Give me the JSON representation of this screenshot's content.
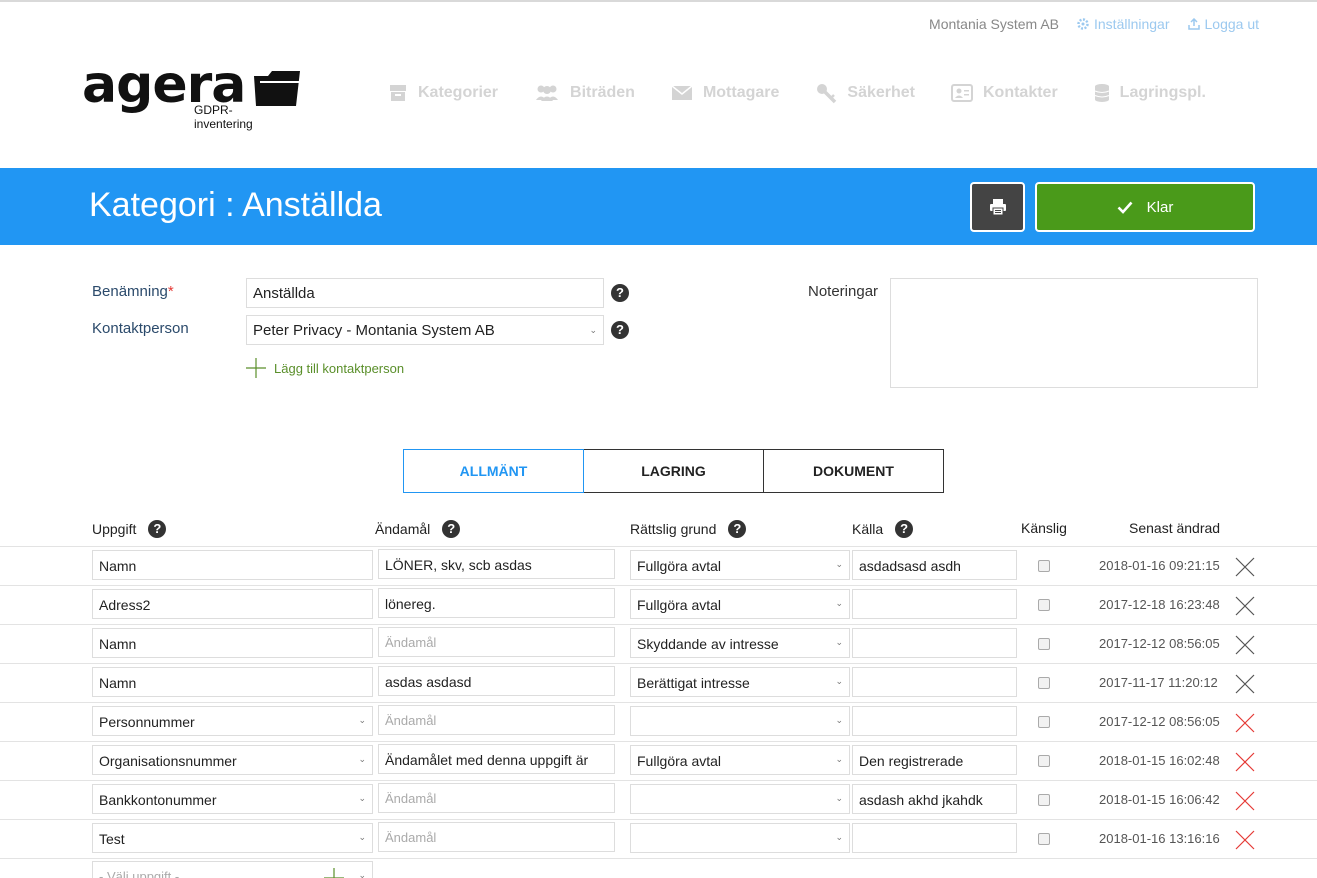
{
  "topbar": {
    "company": "Montania System AB",
    "settings": "Inställningar",
    "logout": "Logga ut"
  },
  "logo": {
    "word": "agera",
    "sub": "GDPR-inventering"
  },
  "nav": [
    {
      "label": "Kategorier",
      "icon": "archive-icon"
    },
    {
      "label": "Biträden",
      "icon": "users-icon"
    },
    {
      "label": "Mottagare",
      "icon": "envelope-icon"
    },
    {
      "label": "Säkerhet",
      "icon": "key-icon"
    },
    {
      "label": "Kontakter",
      "icon": "contact-card-icon"
    },
    {
      "label": "Lagringspl.",
      "icon": "database-icon"
    }
  ],
  "header": {
    "title": "Kategori : Anställda",
    "done_label": "Klar"
  },
  "form": {
    "name_label": "Benämning",
    "name_value": "Anställda",
    "contact_label": "Kontaktperson",
    "contact_value": "Peter Privacy - Montania System AB",
    "add_contact": "Lägg till kontaktperson",
    "notes_label": "Noteringar"
  },
  "tabs": [
    "ALLMÄNT",
    "LAGRING",
    "DOKUMENT"
  ],
  "columns": {
    "uppgift": "Uppgift",
    "andamal": "Ändamål",
    "grund": "Rättslig grund",
    "kalla": "Källa",
    "kanslig": "Känslig",
    "andrad": "Senast ändrad"
  },
  "placeholder_andamal": "Ändamål",
  "rows": [
    {
      "uppgift": "Namn",
      "uppgift_select": false,
      "andamal": "LÖNER, skv, scb asdas",
      "grund": "Fullgöra avtal",
      "kalla": "asdadsasd asdh",
      "date": "2018-01-16 09:21:15",
      "del_color": "#555555"
    },
    {
      "uppgift": "Adress2",
      "uppgift_select": false,
      "andamal": "lönereg.",
      "grund": "Fullgöra avtal",
      "kalla": "",
      "date": "2017-12-18 16:23:48",
      "del_color": "#555555"
    },
    {
      "uppgift": "Namn",
      "uppgift_select": false,
      "andamal": "",
      "grund": "Skyddande av intresse",
      "kalla": "",
      "date": "2017-12-12 08:56:05",
      "del_color": "#555555"
    },
    {
      "uppgift": "Namn",
      "uppgift_select": false,
      "andamal": "asdas asdasd",
      "grund": "Berättigat intresse",
      "kalla": "",
      "date": "2017-11-17 11:20:12",
      "del_color": "#555555"
    },
    {
      "uppgift": "Personnummer",
      "uppgift_select": true,
      "andamal": "",
      "grund": "",
      "kalla": "",
      "date": "2017-12-12 08:56:05",
      "del_color": "#e53935"
    },
    {
      "uppgift": "Organisationsnummer",
      "uppgift_select": true,
      "andamal": "Ändamålet med denna uppgift är",
      "grund": "Fullgöra avtal",
      "kalla": "Den registrerade",
      "date": "2018-01-15 16:02:48",
      "del_color": "#e53935"
    },
    {
      "uppgift": "Bankkontonummer",
      "uppgift_select": true,
      "andamal": "",
      "grund": "",
      "kalla": "asdash akhd jkahdk",
      "date": "2018-01-15 16:06:42",
      "del_color": "#e53935"
    },
    {
      "uppgift": "Test",
      "uppgift_select": true,
      "andamal": "",
      "grund": "",
      "kalla": "",
      "date": "2018-01-16 13:16:16",
      "del_color": "#e53935"
    }
  ],
  "new_row_placeholder": "- Välj uppgift -",
  "colors": {
    "brand_blue": "#2196f3",
    "done_green": "#4a9a1a",
    "print_dark": "#444444",
    "link_blue": "#9cc9ef",
    "add_green": "#5a8f2a"
  }
}
